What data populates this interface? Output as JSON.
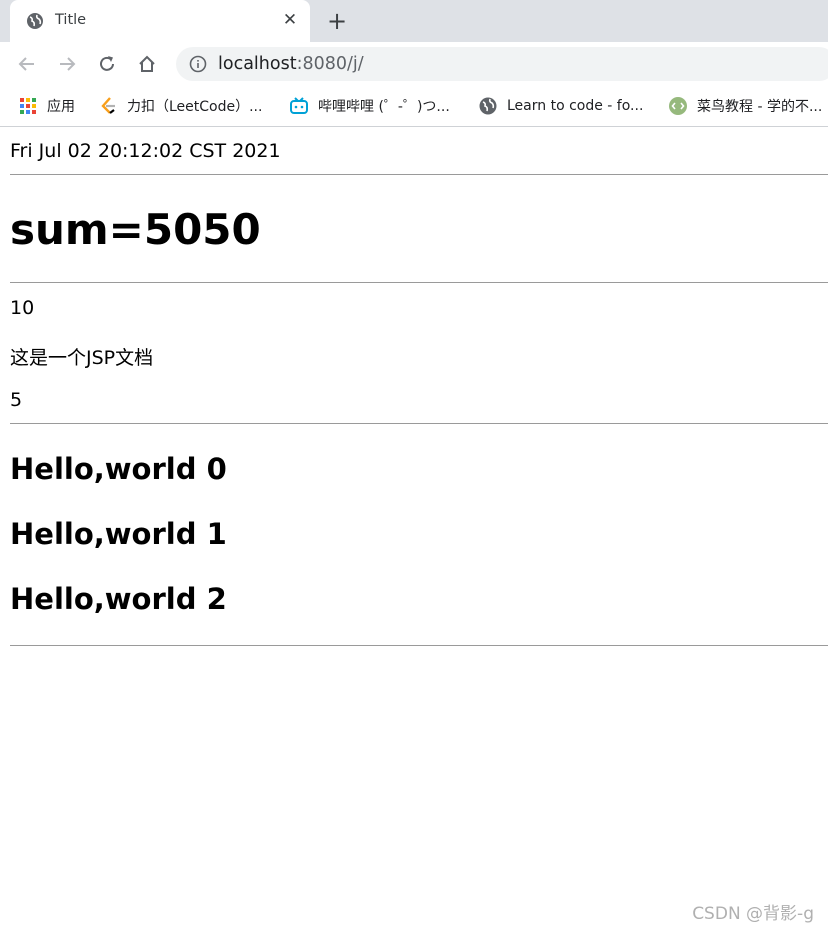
{
  "browser": {
    "tab": {
      "title": "Title",
      "favicon": "globe-icon",
      "close_icon": "close-icon"
    },
    "new_tab_icon": "plus-icon",
    "address": {
      "host": "localhost",
      "path": ":8080/j/"
    },
    "bookmarks": [
      {
        "label": "应用",
        "icon": "apps-grid-icon"
      },
      {
        "label": "力扣（LeetCode）...",
        "icon": "leetcode-icon"
      },
      {
        "label": "哔哩哔哩 (゜-゜)つ...",
        "icon": "bilibili-icon"
      },
      {
        "label": "Learn to code - fo...",
        "icon": "globe-icon"
      },
      {
        "label": "菜鸟教程 - 学的不...",
        "icon": "runoob-icon"
      }
    ]
  },
  "page": {
    "date": "Fri Jul 02 20:12:02 CST 2021",
    "sum": "sum=5050",
    "lines": [
      "10",
      "这是一个JSP文档",
      "5"
    ],
    "hellos": [
      "Hello,world 0",
      "Hello,world 1",
      "Hello,world 2"
    ]
  },
  "watermark": "CSDN @背影-g",
  "colors": {
    "tabstrip": "#dee1e6",
    "omnibox": "#f1f3f4",
    "rule": "#9a9a9a"
  }
}
